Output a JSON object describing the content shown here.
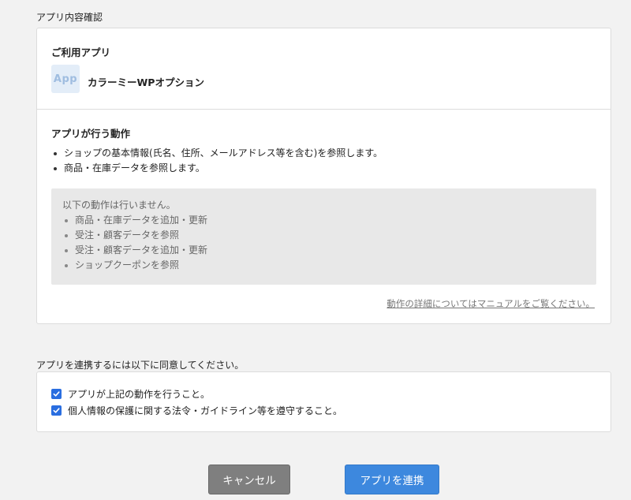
{
  "app_section": {
    "heading": "アプリ内容確認",
    "app_label": "ご利用アプリ",
    "app_icon_text": "App",
    "app_name": "カラーミーWPオプション",
    "actions_label": "アプリが行う動作",
    "actions": [
      "ショップの基本情報(氏名、住所、メールアドレス等を含む)を参照します。",
      "商品・在庫データを参照します。"
    ],
    "not_performed": {
      "title": "以下の動作は行いません。",
      "items": [
        "商品・在庫データを追加・更新",
        "受注・顧客データを参照",
        "受注・顧客データを追加・更新",
        "ショップクーポンを参照"
      ]
    },
    "manual_link": "動作の詳細についてはマニュアルをご覧ください。"
  },
  "consent_section": {
    "heading": "アプリを連携するには以下に同意してください。",
    "checks": [
      {
        "label": "アプリが上記の動作を行うこと。",
        "checked": true
      },
      {
        "label": "個人情報の保護に関する法令・ガイドライン等を遵守すること。",
        "checked": true
      }
    ]
  },
  "buttons": {
    "cancel": "キャンセル",
    "connect": "アプリを連携"
  },
  "colors": {
    "background": "#f2f2f2",
    "primary_button": "#3d88de",
    "cancel_button": "#7f7f7f",
    "checkbox": "#2a6ee0",
    "app_icon_bg": "#e3edf8"
  }
}
